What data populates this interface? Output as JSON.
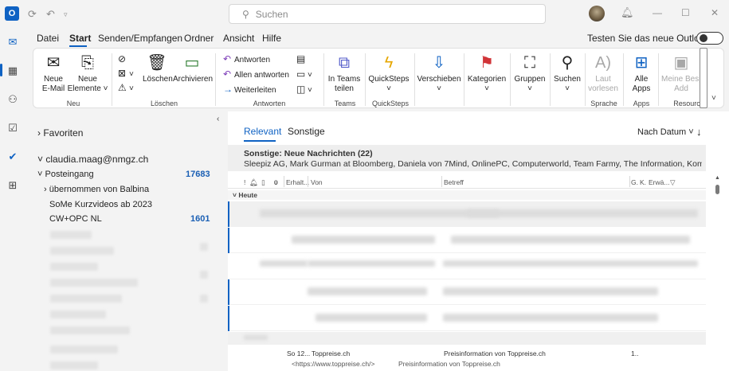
{
  "titlebar": {
    "search_placeholder": "Suchen"
  },
  "menu": {
    "items": [
      "Datei",
      "Start",
      "Senden/Empfangen",
      "Ordner",
      "Ansicht",
      "Hilfe"
    ],
    "new_outlook_label": "Testen Sie das neue Outlook"
  },
  "ribbon": {
    "new_email": "Neue\nE-Mail",
    "new_items": "Neue\nElemente ˅",
    "group_new": "Neu",
    "delete": "Löschen",
    "archive": "Archivieren",
    "group_delete": "Löschen",
    "reply": "Antworten",
    "reply_all": "Allen antworten",
    "forward": "Weiterleiten",
    "group_respond": "Antworten",
    "teams_share": "In Teams\nteilen",
    "group_teams": "Teams",
    "quicksteps": "QuickSteps",
    "group_quicksteps": "QuickSteps",
    "move": "Verschieben",
    "categories": "Kategorien",
    "groups": "Gruppen",
    "find": "Suchen",
    "read_aloud": "Laut\nvorlesen",
    "group_language": "Sprache",
    "all_apps": "Alle\nApps",
    "group_apps": "Apps",
    "meine": "Meine Besp\nAdd",
    "group_resources": "Resourc"
  },
  "folders": {
    "favorites": "Favoriten",
    "account": "claudia.maag@nmgz.ch",
    "inbox": "Posteingang",
    "inbox_count": "17683",
    "sub1": "übernommen von Balbina",
    "sub2": "SoMe Kurzvideos ab 2023",
    "sub3": "CW+OPC NL",
    "sub3_count": "1601"
  },
  "mail": {
    "tab_relevant": "Relevant",
    "tab_other": "Sonstige",
    "sort_label": "Nach Datum ˅",
    "banner_title": "Sonstige: Neue Nachrichten (22)",
    "banner_body": "Sleepiz AG, Mark Gurman at Bloomberg, Daniela von 7Mind, OnlinePC, Computerworld, Team Farmy, The Information, Komoot, Crossiety,...",
    "col_received": "Erhalt...",
    "col_from": "Von",
    "col_subject": "Betreff",
    "col_g": "G.",
    "col_k": "K.",
    "col_size": "Erwä...",
    "group_today": "Heute",
    "last_row": {
      "date": "So 12...",
      "from": "Toppreise.ch",
      "subject": "Preisinformation von Toppreise.ch",
      "size": "1..",
      "preview_url": "<https://www.toppreise.ch/>",
      "preview_text": "Preisinformation von Toppreise.ch"
    }
  }
}
